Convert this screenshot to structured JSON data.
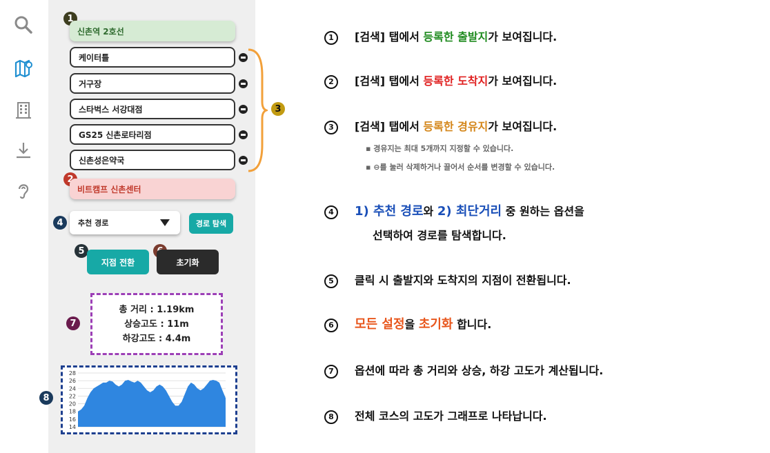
{
  "rail": {
    "icons": [
      "search-icon",
      "map-icon",
      "building-icon",
      "download-icon",
      "ear-icon"
    ]
  },
  "markers": {
    "m1": "1",
    "m2": "2",
    "m3": "3",
    "m4": "4",
    "m5": "5",
    "m6": "6",
    "m7": "7",
    "m8": "8"
  },
  "route": {
    "start": "신촌역 2호선",
    "waypoints": [
      "케이터틀",
      "거구장",
      "스타벅스 서강대점",
      "GS25 신촌로타리점",
      "신촌성은약국"
    ],
    "end": "비트캠프 신촌센터"
  },
  "controls": {
    "route_option": "추천 경로",
    "search_label": "경로 탐색",
    "swap_label": "지점 전환",
    "reset_label": "초기화"
  },
  "stats": {
    "distance": "총 거리 : 1.19km",
    "ascent": "상승고도 : 11m",
    "descent": "하강고도 : 4.4m"
  },
  "chart_data": {
    "type": "area",
    "title": "",
    "xlabel": "",
    "ylabel": "",
    "ylim": [
      14,
      28
    ],
    "yticks": [
      "28",
      "26",
      "24",
      "22",
      "20",
      "18",
      "16",
      "14"
    ],
    "values": [
      18,
      18.5,
      19.5,
      21.5,
      23,
      24,
      24.5,
      25,
      25.5,
      25.5,
      26,
      25.8,
      25,
      24.5,
      25,
      26,
      26.2,
      25.8,
      25.5,
      26,
      25.5,
      24.5,
      23.5,
      23,
      23.5,
      24.5,
      25,
      24.5,
      23.5,
      22,
      20.5,
      19.5,
      19.5,
      20.5,
      22.5,
      24.5,
      25.5,
      25,
      24,
      23.5,
      24,
      25,
      26,
      26.2,
      26,
      25.5,
      23.5,
      21.5
    ],
    "colors": {
      "fill": "#2f86e0"
    }
  },
  "descriptions": {
    "d1": {
      "num": "①",
      "pre": "[검색] 탭에서 ",
      "hl": "등록한 출발지",
      "post": "가 보여집니다."
    },
    "d2": {
      "num": "②",
      "pre": "[검색] 탭에서 ",
      "hl": "등록한 도착지",
      "post": "가 보여집니다."
    },
    "d3": {
      "num": "③",
      "pre": "[검색] 탭에서 ",
      "hl": "등록한 경유지",
      "post": "가 보여집니다.",
      "sub1": "▪ 경유지는 최대 5개까지 지정할 수 있습니다.",
      "sub2": "▪ ⊖를 눌러 삭제하거나 끌어서 순서를 변경할 수 있습니다."
    },
    "d4": {
      "num": "④",
      "hl1": "1) 추천 경로",
      "mid": "와 ",
      "hl2": "2) 최단거리",
      "post": " 중 원하는 옵션을",
      "line2": "선택하여 경로를 탐색합니다."
    },
    "d5": {
      "num": "⑤",
      "text": "클릭 시 출발지와 도착지의 지점이 전환됩니다."
    },
    "d6": {
      "num": "⑥",
      "hl1": "모든 설정",
      "mid": "을 ",
      "hl2": "초기화",
      "post": " 합니다."
    },
    "d7": {
      "num": "⑦",
      "text": "옵션에 따라 총 거리와 상승, 하강 고도가 계산됩니다."
    },
    "d8": {
      "num": "⑧",
      "text": "전체 코스의 고도가 그래프로 나타납니다."
    }
  }
}
